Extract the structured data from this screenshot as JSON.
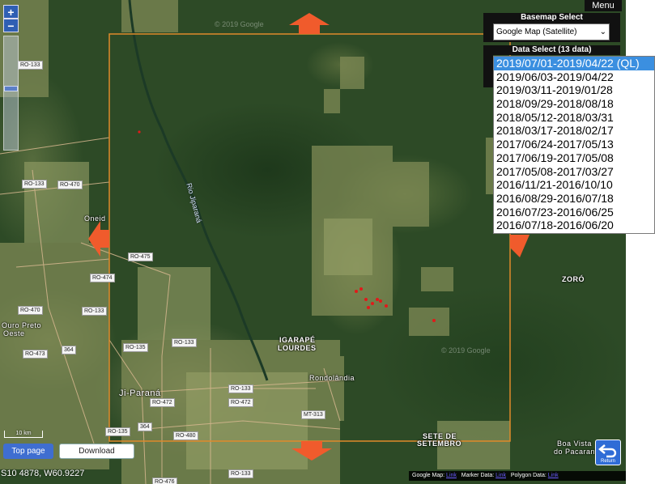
{
  "zoom": {
    "in_label": "+",
    "out_label": "−"
  },
  "menu_label": "Menu",
  "basemap": {
    "header": "Basemap Select",
    "selected": "Google Map (Satellite)"
  },
  "data_select": {
    "header": "Data Select (13 data)",
    "items": [
      "2019/07/01-2019/04/22 (QL)",
      "2019/06/03-2019/04/22",
      "2019/03/11-2019/01/28",
      "2018/09/29-2018/08/18",
      "2018/05/12-2018/03/31",
      "2018/03/17-2018/02/17",
      "2017/06/24-2017/05/13",
      "2017/06/19-2017/05/08",
      "2017/05/08-2017/03/27",
      "2016/11/21-2016/10/10",
      "2016/08/29-2016/07/18",
      "2016/07/23-2016/06/25",
      "2016/07/18-2016/06/20"
    ],
    "selected_index": 0
  },
  "buttons": {
    "top_page": "Top page",
    "download": "Download",
    "return": "Return"
  },
  "coordinates": "S10 4878, W60.9227",
  "scale": "10 km",
  "attribution": {
    "google": "Google Map:",
    "marker": "Marker Data:",
    "polygon": "Polygon Data:",
    "link": "Link"
  },
  "watermark": "© 2019 Google",
  "places": {
    "river": "Rio Jiparaná",
    "igarape": "IGARAPÉ",
    "lourdes": "LOURDES",
    "rondolandia": "Rondolândia",
    "ji_parana": "Ji-Paraná",
    "sete": "SETE DE",
    "setembro": "SETEMBRO",
    "zoro": "ZORÓ",
    "boa_vista": "Boa Vista",
    "do_pacarana": "do Pacarana",
    "ouro_preto": "Ouro Preto",
    "oeste": "Oeste",
    "oneido": "Oneid"
  },
  "roads": {
    "ro133a": "RO-133",
    "ro133b": "RO-133",
    "ro133c": "RO-133",
    "ro133d": "RO-133",
    "ro470a": "RO-470",
    "ro470b": "RO-470",
    "ro475": "RO-475",
    "ro474": "RO-474",
    "ro135a": "RO-135",
    "ro135b": "RO-135",
    "ro473": "RO-473",
    "ro472a": "RO-472",
    "ro472b": "RO-472",
    "ro480": "RO-480",
    "ro476": "RO-476",
    "mt313": "MT-313",
    "br364a": "364",
    "br364b": "364"
  },
  "colors": {
    "aoi_border": "#e08a2a",
    "arrow": "#f05b2c",
    "marker": "#e11a1a",
    "selected_item": "#3b8fe0",
    "panel_bg": "#111111",
    "top_button": "#3f6ed0"
  }
}
